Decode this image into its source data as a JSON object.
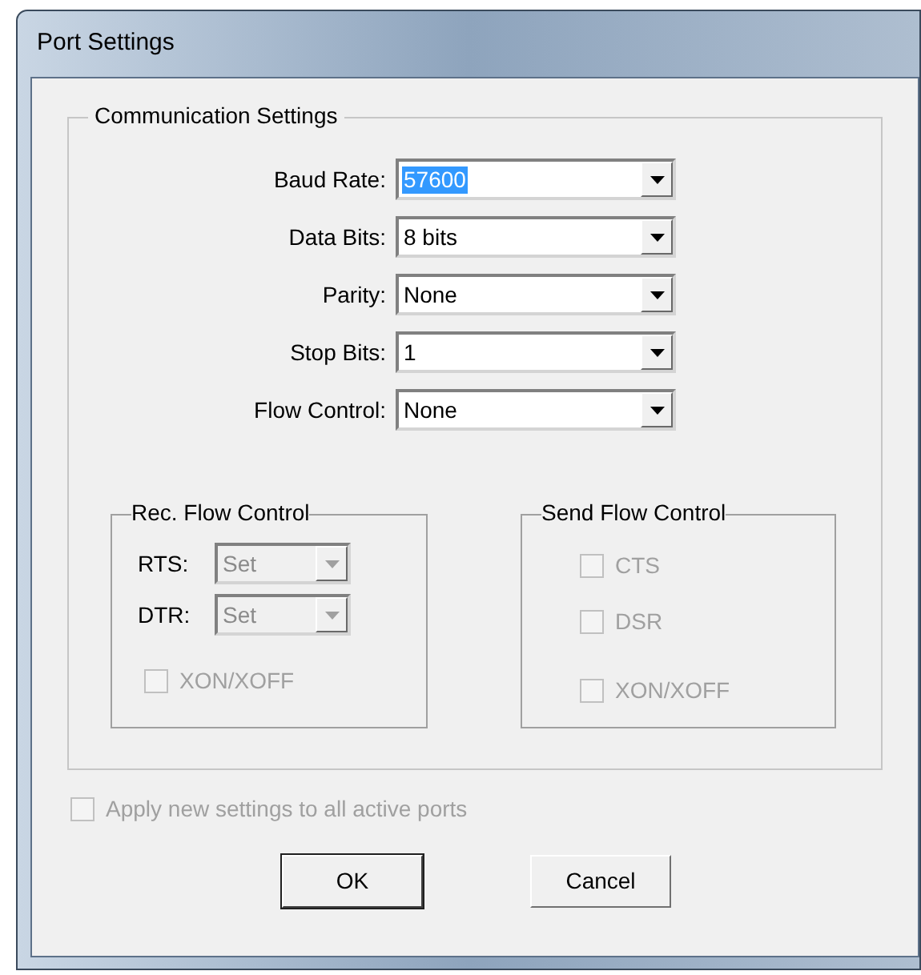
{
  "window": {
    "title": "Port Settings"
  },
  "communication_settings": {
    "title": "Communication Settings",
    "fields": [
      {
        "label": "Baud Rate:",
        "value": "57600",
        "text_selected": true
      },
      {
        "label": "Data Bits:",
        "value": "8 bits",
        "text_selected": false
      },
      {
        "label": "Parity:",
        "value": "None",
        "text_selected": false
      },
      {
        "label": "Stop Bits:",
        "value": "1",
        "text_selected": false
      },
      {
        "label": "Flow Control:",
        "value": "None",
        "text_selected": false
      }
    ]
  },
  "rec_flow_control": {
    "title": "Rec. Flow Control",
    "fields": [
      {
        "label": "RTS:",
        "value": "Set",
        "disabled": true
      },
      {
        "label": "DTR:",
        "value": "Set",
        "disabled": true
      }
    ],
    "checkboxes": [
      {
        "label": "XON/XOFF",
        "checked": false,
        "disabled": true
      }
    ]
  },
  "send_flow_control": {
    "title": "Send Flow Control",
    "checkboxes": [
      {
        "label": "CTS",
        "checked": false,
        "disabled": true
      },
      {
        "label": "DSR",
        "checked": false,
        "disabled": true
      },
      {
        "label": "XON/XOFF",
        "checked": false,
        "disabled": true
      }
    ]
  },
  "apply_all": {
    "label": "Apply new settings to all active ports",
    "checked": false,
    "disabled": true
  },
  "buttons": [
    {
      "label": "OK",
      "default": true
    },
    {
      "label": "Cancel",
      "default": false
    }
  ]
}
